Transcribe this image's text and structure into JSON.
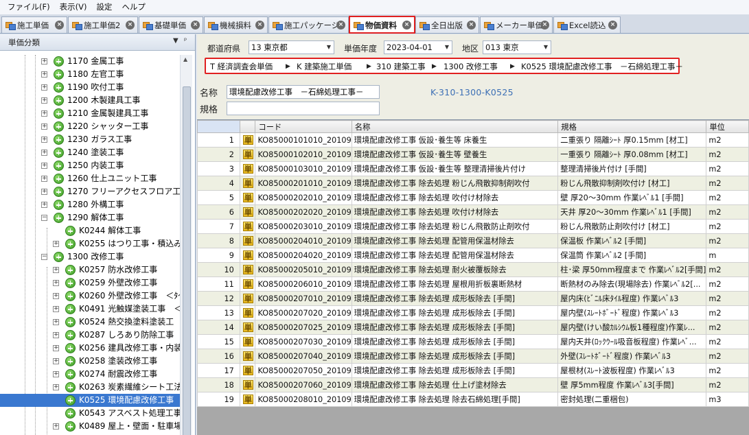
{
  "menu": [
    "ファイル(F)",
    "表示(V)",
    "設定",
    "ヘルプ"
  ],
  "tabs": [
    {
      "label": "施工単価",
      "active": false
    },
    {
      "label": "施工単価2",
      "active": false
    },
    {
      "label": "基礎単価",
      "active": false
    },
    {
      "label": "機械損料",
      "active": false
    },
    {
      "label": "施工パッケージ",
      "active": false
    },
    {
      "label": "物価資料",
      "active": true
    },
    {
      "label": "全日出版",
      "active": false
    },
    {
      "label": "メーカー単価",
      "active": false
    },
    {
      "label": "Excel読込",
      "active": false
    }
  ],
  "left_panel": {
    "title": "単価分類",
    "pin_glyph": "▾ ᵖ",
    "tree": [
      {
        "label": "1170 金属工事",
        "level": 1,
        "expander": "+"
      },
      {
        "label": "1180 左官工事",
        "level": 1,
        "expander": "+"
      },
      {
        "label": "1190 吹付工事",
        "level": 1,
        "expander": "+"
      },
      {
        "label": "1200 木製建具工事",
        "level": 1,
        "expander": "+"
      },
      {
        "label": "1210 金属製建具工事",
        "level": 1,
        "expander": "+"
      },
      {
        "label": "1220 シャッター工事",
        "level": 1,
        "expander": "+"
      },
      {
        "label": "1230 ガラス工事",
        "level": 1,
        "expander": "+"
      },
      {
        "label": "1240 塗装工事",
        "level": 1,
        "expander": "+"
      },
      {
        "label": "1250 内装工事",
        "level": 1,
        "expander": "+"
      },
      {
        "label": "1260 仕上ユニット工事",
        "level": 1,
        "expander": "+"
      },
      {
        "label": "1270 フリーアクセスフロア工事",
        "level": 1,
        "expander": "+"
      },
      {
        "label": "1280 外構工事",
        "level": 1,
        "expander": "+"
      },
      {
        "label": "1290 解体工事",
        "level": 1,
        "expander": "−"
      },
      {
        "label": "K0244 解体工事",
        "level": 2,
        "expander": ""
      },
      {
        "label": "K0255 はつり工事・積込み",
        "level": 2,
        "expander": "+"
      },
      {
        "label": "1300 改修工事",
        "level": 1,
        "expander": "−"
      },
      {
        "label": "K0257 防水改修工事",
        "level": 2,
        "expander": "+"
      },
      {
        "label": "K0259 外壁改修工事",
        "level": 2,
        "expander": "+"
      },
      {
        "label": "K0260 外壁改修工事　＜ﾀｲ",
        "level": 2,
        "expander": "+"
      },
      {
        "label": "K0491 光触媒塗装工事　＜",
        "level": 2,
        "expander": "+"
      },
      {
        "label": "K0524 熱交換塗料塗装工",
        "level": 2,
        "expander": "+"
      },
      {
        "label": "K0287 しろあり防除工事　＜",
        "level": 2,
        "expander": "+"
      },
      {
        "label": "K0256 建具改修工事・内装",
        "level": 2,
        "expander": "+"
      },
      {
        "label": "K0258 塗装改修工事",
        "level": 2,
        "expander": "+"
      },
      {
        "label": "K0274 耐震改修工事",
        "level": 2,
        "expander": "+"
      },
      {
        "label": "K0263 炭素繊維シート工法",
        "level": 2,
        "expander": "+"
      },
      {
        "label": "K0525 環境配慮改修工事",
        "level": 2,
        "expander": "",
        "selected": true
      },
      {
        "label": "K0543 アスベスト処理工事",
        "level": 2,
        "expander": ""
      },
      {
        "label": "K0489 屋上・壁面・駐車場",
        "level": 2,
        "expander": "+"
      }
    ]
  },
  "filters": {
    "prefecture_label": "都道府県",
    "prefecture_value": "13 東京都",
    "year_label": "単価年度",
    "year_value": "2023-04-01",
    "region_label": "地区",
    "region_value": "013 東京"
  },
  "breadcrumb": [
    "T 経済調査会単価",
    "K 建築施工単価",
    "310 建築工事",
    "1300 改修工事",
    "K0525 環境配慮改修工事　－石綿処理工事－"
  ],
  "detail": {
    "name_label": "名称",
    "name_value": "環境配慮改修工事　－石綿処理工事－",
    "spec_label": "規格",
    "spec_value": "",
    "code_display": "K-310-1300-K0525"
  },
  "grid": {
    "headers": [
      "",
      "",
      "コード",
      "名称",
      "規格",
      "単位"
    ],
    "icon_glyph": "単",
    "rows": [
      {
        "no": "1",
        "code": "KO85000101010_20109",
        "name": "環境配慮改修工事 仮設･養生等 床養生",
        "spec": "二重張り 隔離ｼｰﾄ 厚0.15mm [材工]",
        "unit": "m2"
      },
      {
        "no": "2",
        "code": "KO85000102010_20109",
        "name": "環境配慮改修工事 仮設･養生等 壁養生",
        "spec": "一重張り 隔離ｼｰﾄ 厚0.08mm [材工]",
        "unit": "m2"
      },
      {
        "no": "3",
        "code": "KO85000103010_20109",
        "name": "環境配慮改修工事 仮設･養生等 整理清掃後片付け",
        "spec": "整理清掃後片付け [手間]",
        "unit": "m2"
      },
      {
        "no": "4",
        "code": "KO85000201010_20109",
        "name": "環境配慮改修工事 除去処理 粉じん飛散抑制剤吹付",
        "spec": "粉じん飛散抑制剤吹付け [材工]",
        "unit": "m2"
      },
      {
        "no": "5",
        "code": "KO85000202010_20109",
        "name": "環境配慮改修工事 除去処理 吹付け材除去",
        "spec": "壁 厚20～30mm 作業ﾚﾍﾞﾙ1 [手間]",
        "unit": "m2"
      },
      {
        "no": "6",
        "code": "KO85000202020_20109",
        "name": "環境配慮改修工事 除去処理 吹付け材除去",
        "spec": "天井 厚20～30mm 作業ﾚﾍﾞﾙ1 [手間]",
        "unit": "m2"
      },
      {
        "no": "7",
        "code": "KO85000203010_20109",
        "name": "環境配慮改修工事 除去処理 粉じん飛散防止剤吹付",
        "spec": "粉じん飛散防止剤吹付け [材工]",
        "unit": "m2"
      },
      {
        "no": "8",
        "code": "KO85000204010_20109",
        "name": "環境配慮改修工事 除去処理 配管用保温材除去",
        "spec": "保温板 作業ﾚﾍﾞﾙ2 [手間]",
        "unit": "m2"
      },
      {
        "no": "9",
        "code": "KO85000204020_20109",
        "name": "環境配慮改修工事 除去処理 配管用保温材除去",
        "spec": "保温筒 作業ﾚﾍﾞﾙ2 [手間]",
        "unit": "m"
      },
      {
        "no": "10",
        "code": "KO85000205010_20109",
        "name": "環境配慮改修工事 除去処理 耐火被覆板除去",
        "spec": "柱･梁 厚50mm程度まで 作業ﾚﾍﾞﾙ2[手間]",
        "unit": "m2"
      },
      {
        "no": "11",
        "code": "KO85000206010_20109",
        "name": "環境配慮改修工事 除去処理 屋根用折板裏断熱材",
        "spec": "断熱材のみ除去(現場除去) 作業ﾚﾍﾞﾙ2[...",
        "unit": "m2"
      },
      {
        "no": "12",
        "code": "KO85000207010_20109",
        "name": "環境配慮改修工事 除去処理 成形板除去 [手間]",
        "spec": "屋内床(ﾋﾞﾆﾙ床ﾀｲﾙ程度) 作業ﾚﾍﾞﾙ3",
        "unit": "m2"
      },
      {
        "no": "13",
        "code": "KO85000207020_20109",
        "name": "環境配慮改修工事 除去処理 成形板除去 [手間]",
        "spec": "屋内壁(ｽﾚｰﾄﾎﾞｰﾄﾞ程度) 作業ﾚﾍﾞﾙ3",
        "unit": "m2"
      },
      {
        "no": "14",
        "code": "KO85000207025_20109",
        "name": "環境配慮改修工事 除去処理 成形板除去 [手間]",
        "spec": "屋内壁(けい酸ｶﾙｼｳﾑ板1種程度)作業ﾚ...",
        "unit": "m2"
      },
      {
        "no": "15",
        "code": "KO85000207030_20109",
        "name": "環境配慮改修工事 除去処理 成形板除去 [手間]",
        "spec": "屋内天井(ﾛｯｸｳｰﾙ吸音板程度) 作業ﾚﾍﾞ...",
        "unit": "m2"
      },
      {
        "no": "16",
        "code": "KO85000207040_20109",
        "name": "環境配慮改修工事 除去処理 成形板除去 [手間]",
        "spec": "外壁(ｽﾚｰﾄﾎﾞｰﾄﾞ程度) 作業ﾚﾍﾞﾙ3",
        "unit": "m2"
      },
      {
        "no": "17",
        "code": "KO85000207050_20109",
        "name": "環境配慮改修工事 除去処理 成形板除去 [手間]",
        "spec": "屋根材(ｽﾚｰﾄ波板程度) 作業ﾚﾍﾞﾙ3",
        "unit": "m2"
      },
      {
        "no": "18",
        "code": "KO85000207060_20109",
        "name": "環境配慮改修工事 除去処理 仕上げ塗材除去",
        "spec": "壁 厚5mm程度 作業ﾚﾍﾞﾙ3[手間]",
        "unit": "m2"
      },
      {
        "no": "19",
        "code": "KO85000208010_20109",
        "name": "環境配慮改修工事 除去処理 除去石綿処理[手間]",
        "spec": "密封処理(二重梱包)",
        "unit": "m3"
      }
    ]
  },
  "colors": {
    "highlight_border": "#e02020",
    "selection": "#3a78d0",
    "code_text": "#3c6fb5"
  }
}
